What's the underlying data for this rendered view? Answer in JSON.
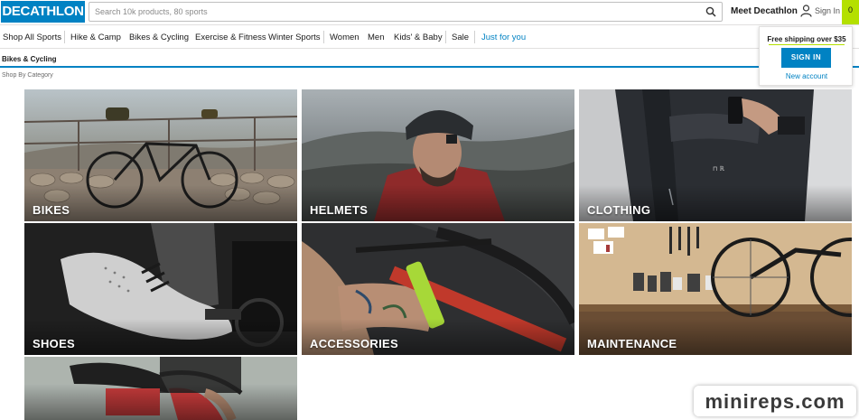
{
  "header": {
    "logo_text": "DECATHLON",
    "search_placeholder": "Search 10k products, 80 sports",
    "meet_label": "Meet Decathlon",
    "signin_label": "Sign In",
    "cart_count": "0",
    "colors": {
      "brand_blue": "#0082c3",
      "cart_green": "#b4e000"
    }
  },
  "nav": {
    "items": [
      {
        "label": "Shop All Sports"
      },
      {
        "label": "Hike & Camp"
      },
      {
        "label": "Bikes & Cycling"
      },
      {
        "label": "Exercise & Fitness"
      },
      {
        "label": "Winter Sports"
      },
      {
        "label": "Women"
      },
      {
        "label": "Men"
      },
      {
        "label": "Kids' & Baby"
      },
      {
        "label": "Sale"
      },
      {
        "label": "Just for you"
      }
    ]
  },
  "breadcrumb": {
    "current": "Bikes & Cycling",
    "section_label": "Shop By Category"
  },
  "account_dropdown": {
    "shipping_text": "Free shipping over $35",
    "signin_button": "SIGN IN",
    "new_account_link": "New account"
  },
  "categories": [
    {
      "label": "BIKES"
    },
    {
      "label": "HELMETS"
    },
    {
      "label": "CLOTHING"
    },
    {
      "label": "SHOES"
    },
    {
      "label": "ACCESSORIES"
    },
    {
      "label": "MAINTENANCE"
    },
    {
      "label": ""
    }
  ],
  "watermark": {
    "text": "minireps.com"
  }
}
